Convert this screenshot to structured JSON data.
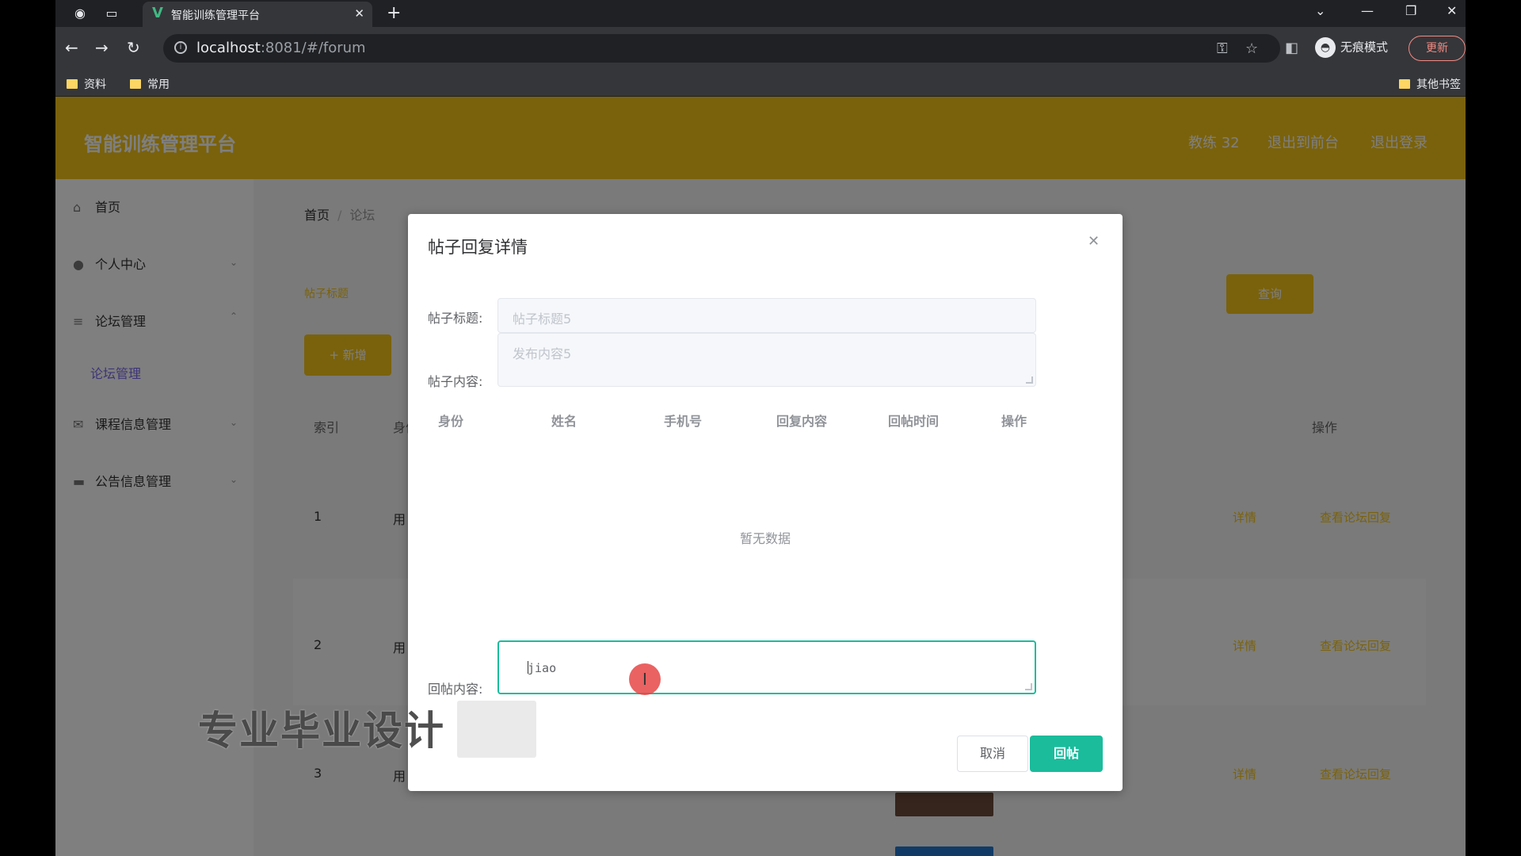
{
  "browser": {
    "tab_title": "智能训练管理平台",
    "url_host": "localhost",
    "url_rest": ":8081/#/forum",
    "profile_label": "无痕模式",
    "update_label": "更新",
    "bookmarks": [
      "资料",
      "常用"
    ],
    "other_bookmarks": "其他书签"
  },
  "app": {
    "title": "智能训练管理平台",
    "header_links": [
      "教练 32",
      "退出到前台",
      "退出登录"
    ],
    "sidebar": {
      "home": "首页",
      "personal": "个人中心",
      "forum_mgmt": "论坛管理",
      "forum_sub": "论坛管理",
      "course": "课程信息管理",
      "notice": "公告信息管理"
    },
    "breadcrumb": {
      "home": "首页",
      "current": "论坛"
    },
    "search_label": "帖子标题",
    "query_button": "查询",
    "add_button": "+ 新增",
    "table_headers": [
      "索引",
      "身份",
      "操作"
    ],
    "rows": [
      {
        "index": "1",
        "user": "用",
        "detail": "详情",
        "view": "查看论坛回复"
      },
      {
        "index": "2",
        "user": "用",
        "detail": "详情",
        "view": "查看论坛回复"
      },
      {
        "index": "3",
        "user": "用",
        "detail": "详情",
        "view": "查看论坛回复"
      }
    ]
  },
  "modal": {
    "title": "帖子回复详情",
    "post_title_label": "帖子标题:",
    "post_title_value": "帖子标题5",
    "post_content_label": "帖子内容:",
    "post_content_value": "发布内容5",
    "columns": [
      "身份",
      "姓名",
      "手机号",
      "回复内容",
      "回帖时间",
      "操作"
    ],
    "empty_text": "暂无数据",
    "reply_label": "回帖内容:",
    "reply_value": "jiao",
    "cancel_button": "取消",
    "reply_button": "回帖"
  },
  "watermark": "专业毕业设计",
  "colors": {
    "header": "#f5c518",
    "primary": "#1abc9c",
    "submenu": "#7b68ee"
  }
}
